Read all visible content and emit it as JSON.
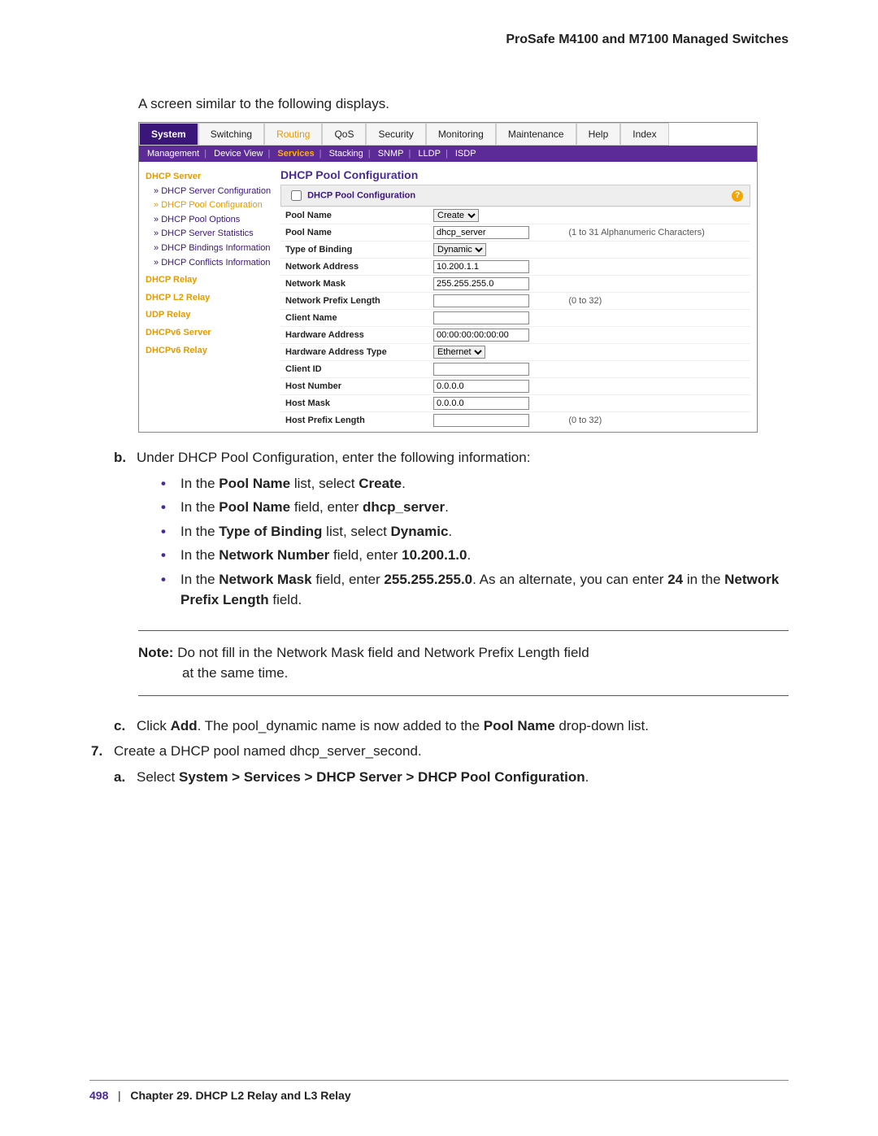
{
  "header": {
    "title": "ProSafe M4100 and M7100 Managed Switches"
  },
  "intro": {
    "text": "A screen similar to the following displays."
  },
  "screenshot": {
    "main_tabs": [
      "System",
      "Switching",
      "Routing",
      "QoS",
      "Security",
      "Monitoring",
      "Maintenance",
      "Help",
      "Index"
    ],
    "active_main_tab": "System",
    "sub_tabs_raw": "Management | Device View | Services | Stacking | SNMP | LLDP | ISDP",
    "sub_tabs": {
      "items": [
        "Management",
        "Device View",
        "Services",
        "Stacking",
        "SNMP",
        "LLDP",
        "ISDP"
      ],
      "highlight": "Services"
    },
    "sidebar": {
      "head1": "DHCP Server",
      "items1": [
        "DHCP Server Configuration",
        "DHCP Pool Configuration",
        "DHCP Pool Options",
        "DHCP Server Statistics",
        "DHCP Bindings Information",
        "DHCP Conflicts Information"
      ],
      "active_index": 1,
      "others": [
        "DHCP Relay",
        "DHCP L2 Relay",
        "UDP Relay",
        "DHCPv6 Server",
        "DHCPv6 Relay"
      ]
    },
    "panel": {
      "title": "DHCP Pool Configuration",
      "subtitle": "DHCP Pool Configuration",
      "help_icon": "?",
      "rows": [
        {
          "label": "Pool Name",
          "type": "select",
          "value": "Create",
          "hint": ""
        },
        {
          "label": "Pool Name",
          "type": "text",
          "value": "dhcp_server",
          "hint": "(1 to 31 Alphanumeric Characters)"
        },
        {
          "label": "Type of Binding",
          "type": "select",
          "value": "Dynamic",
          "hint": ""
        },
        {
          "label": "Network Address",
          "type": "text",
          "value": "10.200.1.1",
          "hint": ""
        },
        {
          "label": "Network Mask",
          "type": "text",
          "value": "255.255.255.0",
          "hint": ""
        },
        {
          "label": "Network Prefix Length",
          "type": "text",
          "value": "",
          "hint": "(0 to 32)"
        },
        {
          "label": "Client Name",
          "type": "text",
          "value": "",
          "hint": ""
        },
        {
          "label": "Hardware Address",
          "type": "text",
          "value": "00:00:00:00:00:00",
          "hint": ""
        },
        {
          "label": "Hardware Address Type",
          "type": "select",
          "value": "Ethernet",
          "hint": ""
        },
        {
          "label": "Client ID",
          "type": "text",
          "value": "",
          "hint": ""
        },
        {
          "label": "Host Number",
          "type": "text",
          "value": "0.0.0.0",
          "hint": ""
        },
        {
          "label": "Host Mask",
          "type": "text",
          "value": "0.0.0.0",
          "hint": ""
        },
        {
          "label": "Host Prefix Length",
          "type": "text",
          "value": "",
          "hint": "(0 to 32)"
        }
      ]
    }
  },
  "instructions": {
    "b_text": "Under DHCP Pool Configuration, enter the following information:",
    "b_letter": "b.",
    "bullets": {
      "b1_pre": "In the ",
      "b1_mid1": "Pool Name",
      "b1_mid2": " list, select ",
      "b1_end": "Create",
      "b1_post": ".",
      "b2_pre": "In the ",
      "b2_mid1": "Pool Name",
      "b2_mid2": " field, enter ",
      "b2_end": "dhcp_server",
      "b2_post": ".",
      "b3_pre": "In the ",
      "b3_mid1": "Type of Binding",
      "b3_mid2": " list, select ",
      "b3_end": "Dynamic",
      "b3_post": ".",
      "b4_pre": "In the ",
      "b4_mid1": "Network Number",
      "b4_mid2": " field, enter ",
      "b4_end": "10.200.1.0",
      "b4_post": ".",
      "b5_pre": "In the ",
      "b5_mid1": "Network Mask",
      "b5_mid2": " field, enter ",
      "b5_end": "255.255.255.0",
      "b5_tail1": ". As an alternate, you can enter ",
      "b5_tail2": "24",
      "b5_tail3": " in the ",
      "b5_tail4": "Network Prefix Length",
      "b5_tail5": " field."
    },
    "note_label": "Note:",
    "note_text1": "Do not fill in the Network Mask field and Network Prefix Length field",
    "note_text2": "at the same time.",
    "c_letter": "c.",
    "c_pre": "Click ",
    "c_bold": "Add",
    "c_mid": ". The pool_dynamic name is now added to the ",
    "c_bold2": "Pool Name",
    "c_post": " drop-down list.",
    "num7": "7.",
    "num7_text": "Create a DHCP pool named dhcp_server_second.",
    "a_letter": "a.",
    "a_pre": "Select ",
    "a_bold": "System > Services > DHCP Server > DHCP Pool Configuration",
    "a_post": "."
  },
  "footer": {
    "page": "498",
    "sep": "|",
    "chapter": "Chapter 29.  DHCP L2 Relay and L3 Relay"
  }
}
